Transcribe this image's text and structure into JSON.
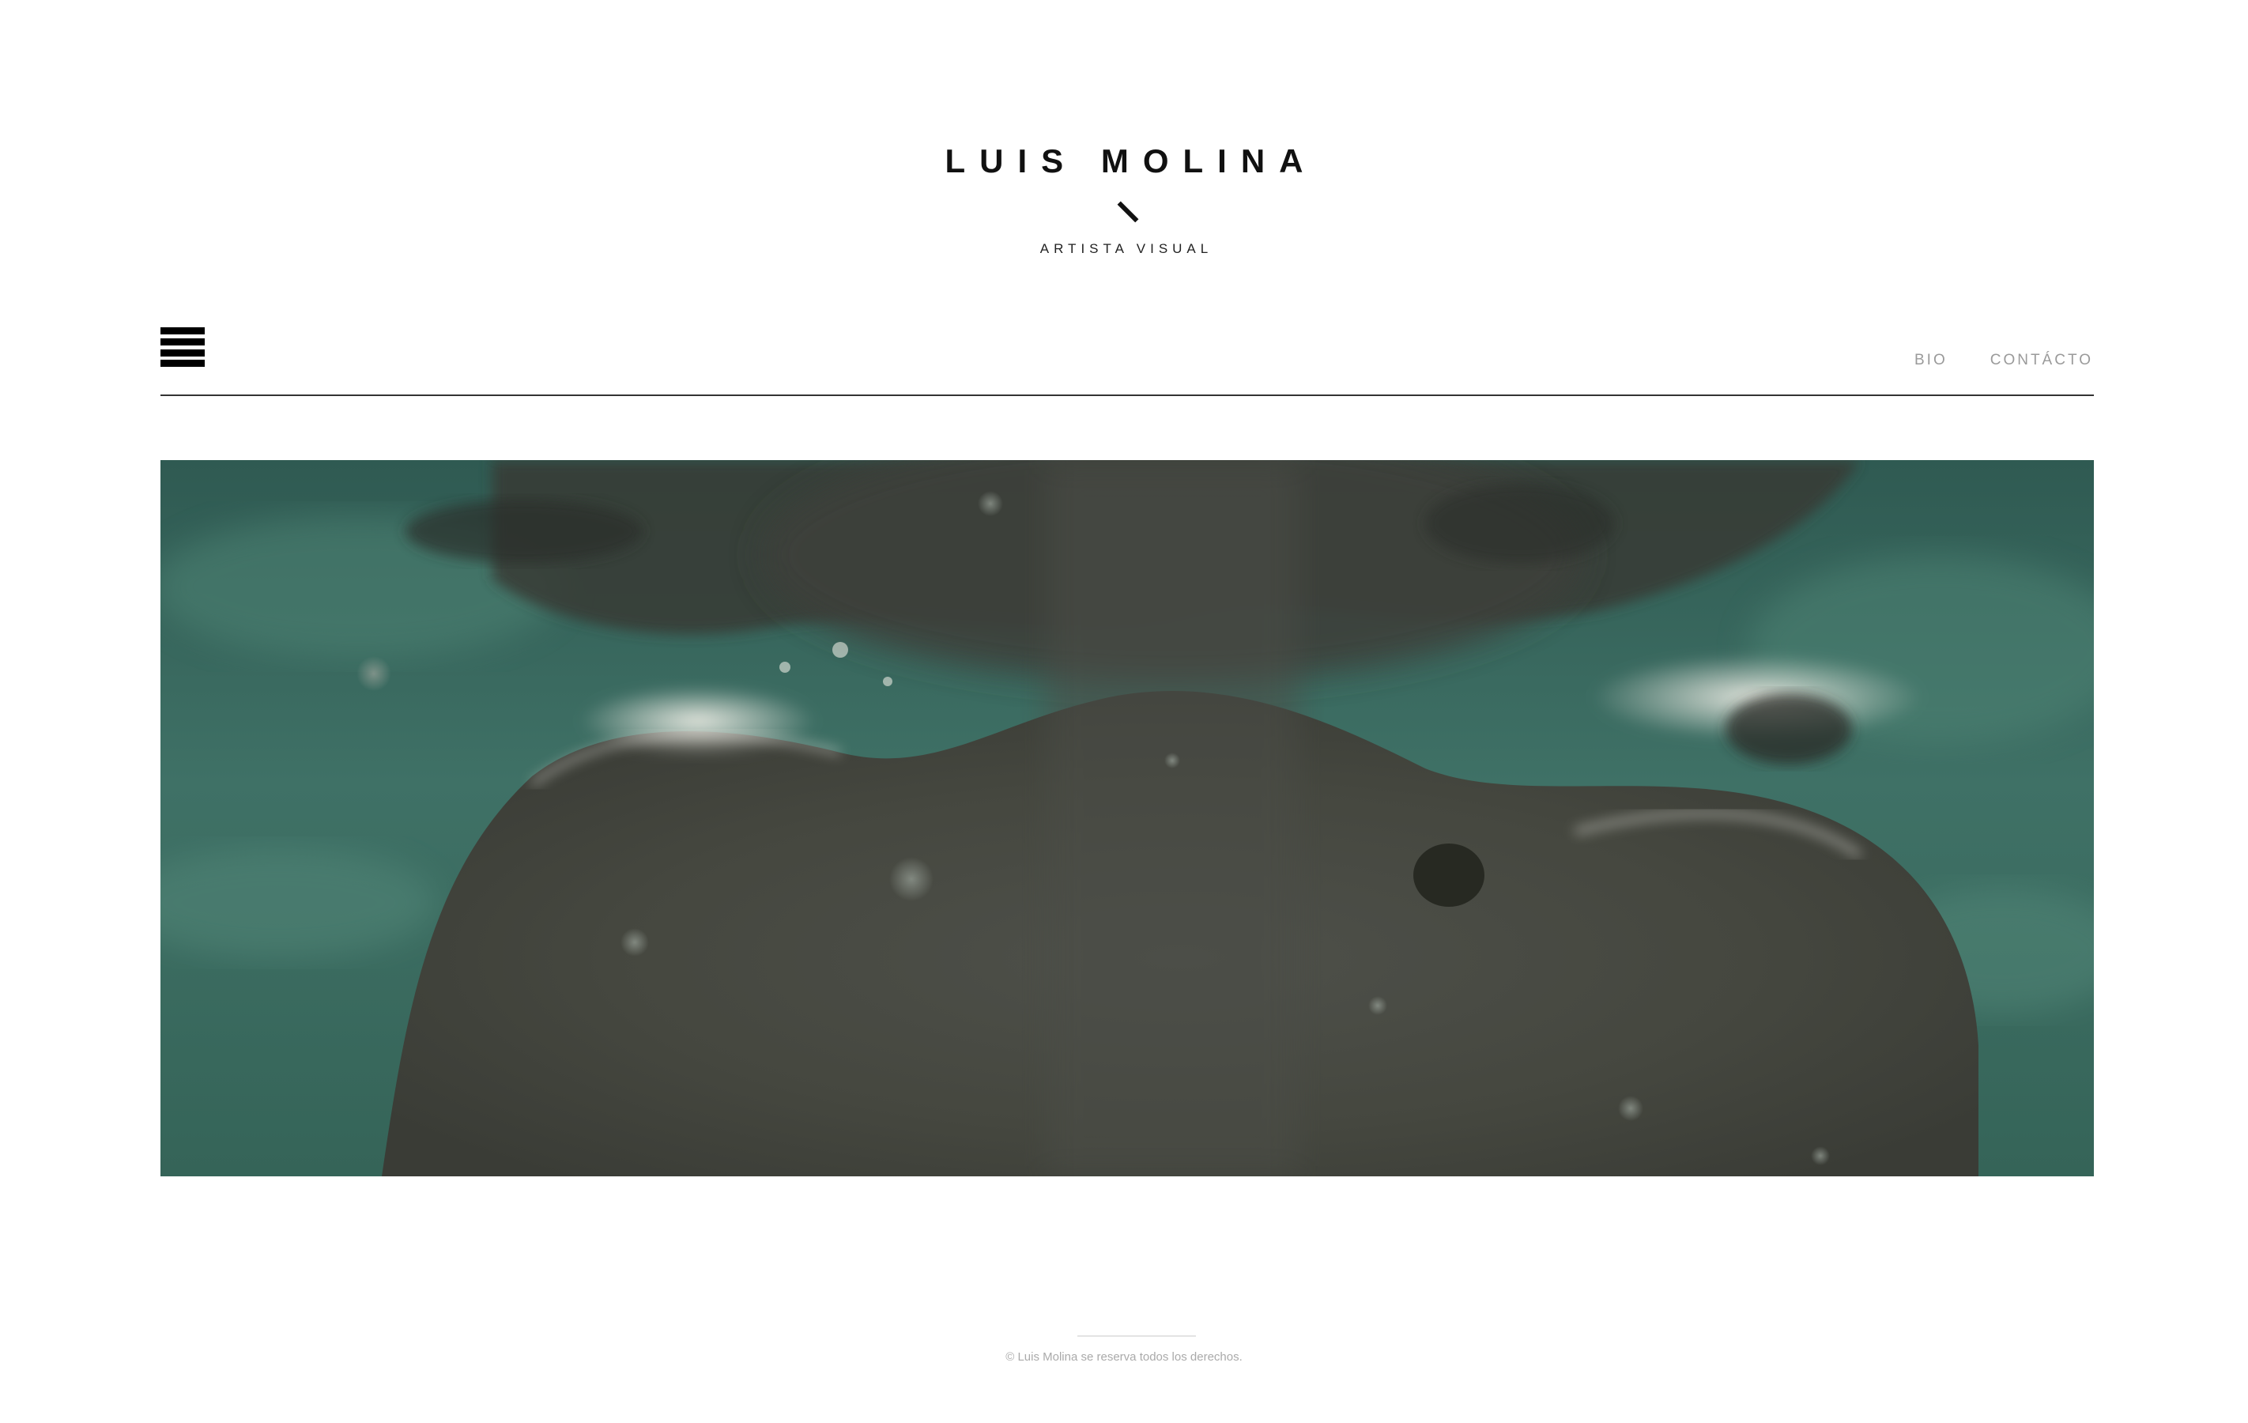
{
  "header": {
    "title": "LUIS MOLINA",
    "subtitle": "ARTISTA VISUAL"
  },
  "nav": {
    "items": [
      {
        "label": "BIO"
      },
      {
        "label": "CONTÁCTO"
      }
    ]
  },
  "hero": {
    "palette": {
      "water": "#3f6d63",
      "water_light": "#5a8a7c",
      "skin_shadow": "#3b3c38",
      "skin_mid": "#55574f",
      "highlight": "#e6e6de"
    }
  },
  "footer": {
    "copyright": "© Luis Molina se reserva todos los derechos."
  }
}
